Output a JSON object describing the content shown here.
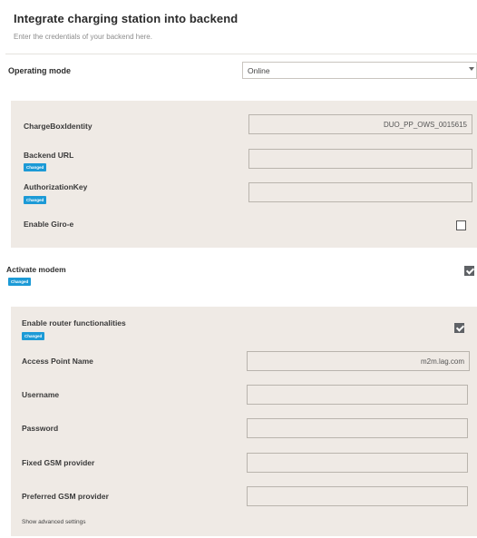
{
  "backend": {
    "title": "Integrate charging station into backend",
    "subtitle": "Enter the credentials of your backend here.",
    "operating_mode": {
      "label": "Operating mode",
      "value": "Online"
    },
    "charge_box_identity": {
      "label": "ChargeBoxIdentity",
      "value": "DUO_PP_OWS_0015615"
    },
    "backend_url": {
      "label": "Backend URL",
      "badge": "Changed",
      "value": ""
    },
    "authorization_key": {
      "label": "AuthorizationKey",
      "badge": "Changed",
      "value": ""
    },
    "giro_e": {
      "label": "Enable Giro-e",
      "checked": false
    }
  },
  "modem": {
    "activate": {
      "label": "Activate modem",
      "badge": "Changed",
      "checked": true
    },
    "router": {
      "label": "Enable router functionalities",
      "badge": "Changed",
      "checked": true
    },
    "apn": {
      "label": "Access Point Name",
      "value": "m2m.lag.com"
    },
    "username": {
      "label": "Username",
      "value": ""
    },
    "password": {
      "label": "Password",
      "value": ""
    },
    "fixed_gsm": {
      "label": "Fixed GSM provider",
      "value": ""
    },
    "preferred_gsm": {
      "label": "Preferred GSM provider",
      "value": ""
    },
    "advanced_link": "Show advanced settings"
  }
}
